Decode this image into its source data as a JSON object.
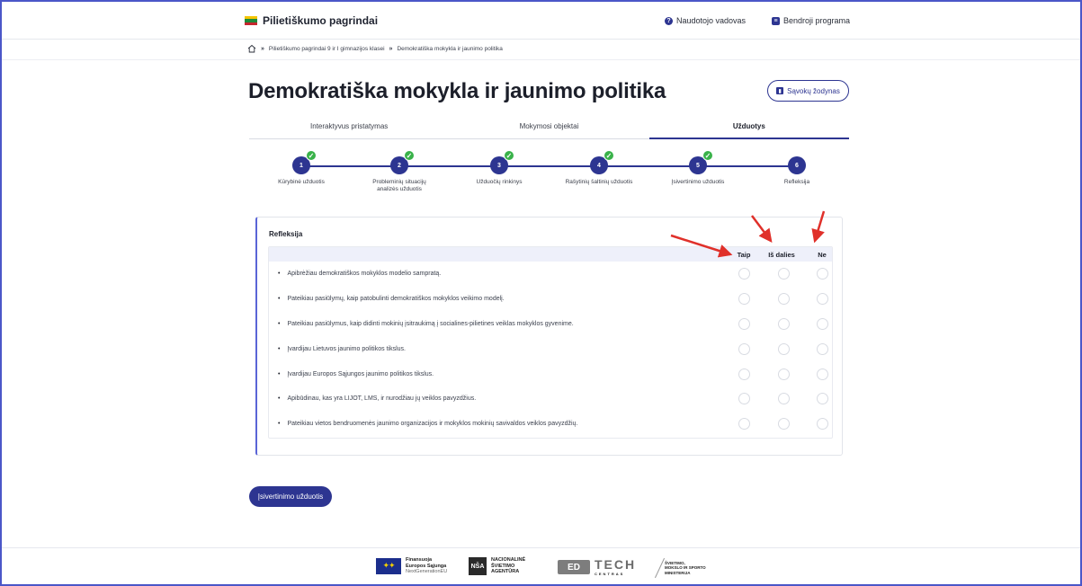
{
  "header": {
    "logo_text": "Pilietiškumo pagrindai",
    "flag_colors": [
      "#f5c400",
      "#1e8a3c",
      "#c4262e"
    ],
    "links": [
      {
        "label": "Naudotojo vadovas",
        "icon": "question-circle-icon"
      },
      {
        "label": "Bendroji programa",
        "icon": "document-icon"
      }
    ]
  },
  "breadcrumb": {
    "items": [
      "Pilietiškumo pagrindai 9 ir I gimnazijos klasei",
      "Demokratiška mokykla ir jaunimo politika"
    ],
    "separator": "»"
  },
  "page": {
    "title": "Demokratiška mokykla ir jaunimo politika",
    "glossary_button": "Sąvokų žodynas"
  },
  "tabs": [
    {
      "label": "Interaktyvus pristatymas",
      "active": false
    },
    {
      "label": "Mokymosi objektai",
      "active": false
    },
    {
      "label": "Užduotys",
      "active": true
    }
  ],
  "steps": [
    {
      "number": "1",
      "label": "Kūrybinė užduotis",
      "done": true
    },
    {
      "number": "2",
      "label": "Probleminių situacijų analizės užduotis",
      "done": true
    },
    {
      "number": "3",
      "label": "Užduočių rinkinys",
      "done": true
    },
    {
      "number": "4",
      "label": "Rašytinių šaltinių užduotis",
      "done": true
    },
    {
      "number": "5",
      "label": "Įsivertinimo užduotis",
      "done": true
    },
    {
      "number": "6",
      "label": "Refleksija",
      "done": false
    }
  ],
  "reflection": {
    "title": "Refleksija",
    "columns": [
      "Taip",
      "Iš dalies",
      "Ne"
    ],
    "rows": [
      "Apibrėžiau demokratiškos mokyklos modelio sampratą.",
      "Pateikiau pasiūlymų, kaip patobulinti demokratiškos mokyklos veikimo modelį.",
      "Pateikiau pasiūlymus, kaip didinti mokinių įsitraukimą į socialines-pilietines veiklas mokyklos gyvenime.",
      "Įvardijau Lietuvos jaunimo politikos tikslus.",
      "Įvardijau Europos Sąjungos jaunimo politikos tikslus.",
      "Apibūdinau, kas yra LIJOT, LMS, ir nurodžiau jų veiklos pavyzdžius.",
      "Pateikiau vietos bendruomenės jaunimo organizacijos ir mokyklos mokinių savivaldos veiklos pavyzdžių."
    ]
  },
  "bottom_button": "Įsivertinimo užduotis",
  "footer": {
    "eu_line1": "Finansuoja",
    "eu_line2": "Europos Sąjunga",
    "eu_line3": "NextGenerationEU",
    "nsa_mark": "NŠA",
    "nsa_line1": "NACIONALINĖ",
    "nsa_line2": "ŠVIETIMO",
    "nsa_line3": "AGENTŪRA",
    "edtech_mark": "ED",
    "edtech_text": "TECH",
    "edtech_sub": "CENTRAS",
    "ministry_line1": "ŠVIETIMO,",
    "ministry_line2": "MOKSLO IR SPORTO",
    "ministry_line3": "MINISTERIJA"
  },
  "colors": {
    "primary": "#2d3591",
    "check": "#39b24a",
    "annotation_arrow": "#e0302a"
  }
}
